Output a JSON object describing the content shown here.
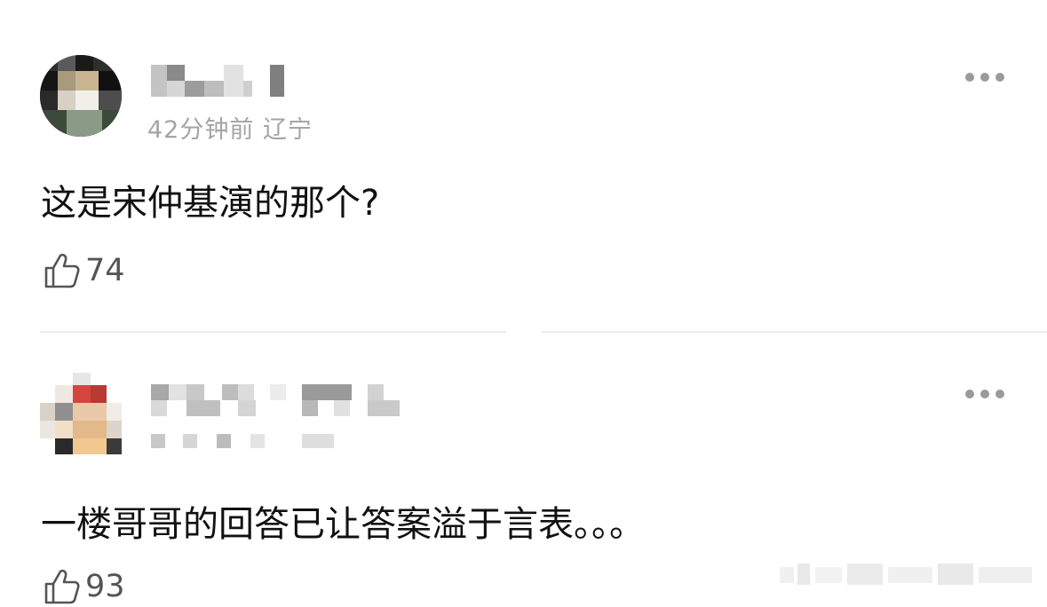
{
  "comments": [
    {
      "username": "",
      "time": "42分钟前",
      "location": "辽宁",
      "text": "这是宋仲基演的那个?",
      "likes": "74",
      "avatar_icon": "pixelated-avatar",
      "like_icon": "thumbs-up-icon",
      "more_icon": "more-dots-icon"
    },
    {
      "username": "",
      "text": "一楼哥哥的回答已让答案溢于言表。。。",
      "likes": "93",
      "avatar_icon": "pixelated-avatar",
      "like_icon": "thumbs-up-icon",
      "more_icon": "more-dots-icon"
    }
  ],
  "colors": {
    "text": "#111111",
    "meta": "#a4a4a4",
    "like_count": "#555555",
    "divider": "#ececec"
  }
}
